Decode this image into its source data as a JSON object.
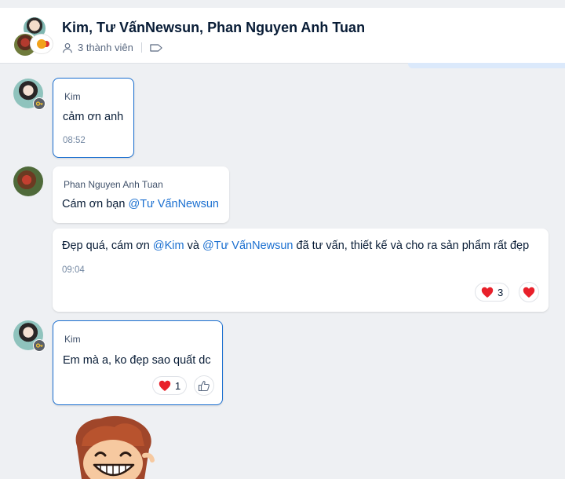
{
  "header": {
    "title": "Kim, Tư VấnNewsun, Phan Nguyen Anh Tuan",
    "member_count": "3 thành viên"
  },
  "messages": [
    {
      "sender": "Kim",
      "text": "cảm ơn anh",
      "time": "08:52"
    },
    {
      "sender": "Phan Nguyen Anh Tuan",
      "text_prefix": "Cám ơn bạn ",
      "mention": "@Tư VấnNewsun"
    },
    {
      "part1": "Đẹp quá, cám ơn ",
      "mention1": "@Kim",
      "part2": " và ",
      "mention2": "@Tư VấnNewsun",
      "part3": " đã tư vấn, thiết kế và cho ra sản phẩm rất đẹp",
      "time": "09:04",
      "reaction_count": "3"
    },
    {
      "sender": "Kim",
      "text": "Em mà a, ko đẹp sao quất dc",
      "reaction_count": "1"
    }
  ],
  "colors": {
    "accent": "#1a6fd0",
    "heart": "#e8202a",
    "text": "#081c36",
    "muted": "#7589a3"
  }
}
